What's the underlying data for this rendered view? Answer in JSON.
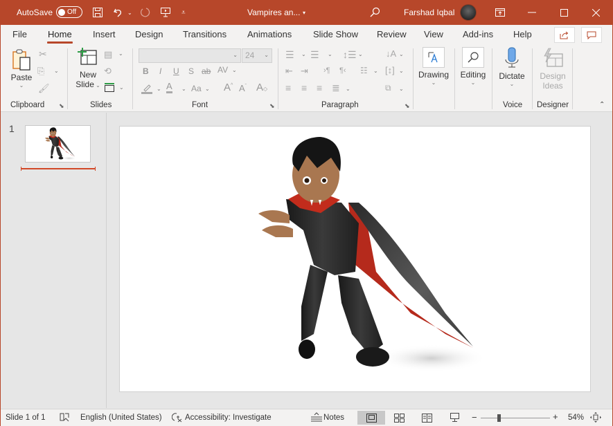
{
  "titlebar": {
    "autosave_label": "AutoSave",
    "autosave_state": "Off",
    "doc_title": "Vampires an...",
    "user_name": "Farshad Iqbal",
    "icons": [
      "save-icon",
      "undo-icon",
      "redo-icon",
      "present-icon",
      "customize-qat-icon",
      "search-icon",
      "ribbon-display-icon",
      "minimize-icon",
      "maximize-icon",
      "close-icon"
    ]
  },
  "tabs": [
    {
      "label": "File"
    },
    {
      "label": "Home",
      "active": true
    },
    {
      "label": "Insert"
    },
    {
      "label": "Design"
    },
    {
      "label": "Transitions"
    },
    {
      "label": "Animations"
    },
    {
      "label": "Slide Show"
    },
    {
      "label": "Review"
    },
    {
      "label": "View"
    },
    {
      "label": "Add-ins"
    },
    {
      "label": "Help"
    }
  ],
  "ribbon": {
    "clipboard": {
      "label": "Clipboard",
      "paste": "Paste"
    },
    "slides": {
      "label": "Slides",
      "new_slide_line1": "New",
      "new_slide_line2": "Slide"
    },
    "font": {
      "label": "Font",
      "font_name": "",
      "font_size": "24"
    },
    "paragraph": {
      "label": "Paragraph"
    },
    "drawing": {
      "label": "Drawing"
    },
    "editing": {
      "label": "Editing"
    },
    "voice": {
      "label": "Voice",
      "dictate": "Dictate"
    },
    "designer": {
      "label": "Designer",
      "design_ideas_line1": "Design",
      "design_ideas_line2": "Ideas"
    }
  },
  "thumbnails": [
    {
      "number": "1"
    }
  ],
  "statusbar": {
    "slide_info": "Slide 1 of 1",
    "language": "English (United States)",
    "accessibility": "Accessibility: Investigate",
    "notes": "Notes",
    "zoom_level": "54%",
    "zoom_minus": "−",
    "zoom_plus": "+"
  },
  "colors": {
    "accent": "#b7472a",
    "ribbon_bg": "#f3f2f1",
    "workspace_bg": "#e6e6e6"
  }
}
